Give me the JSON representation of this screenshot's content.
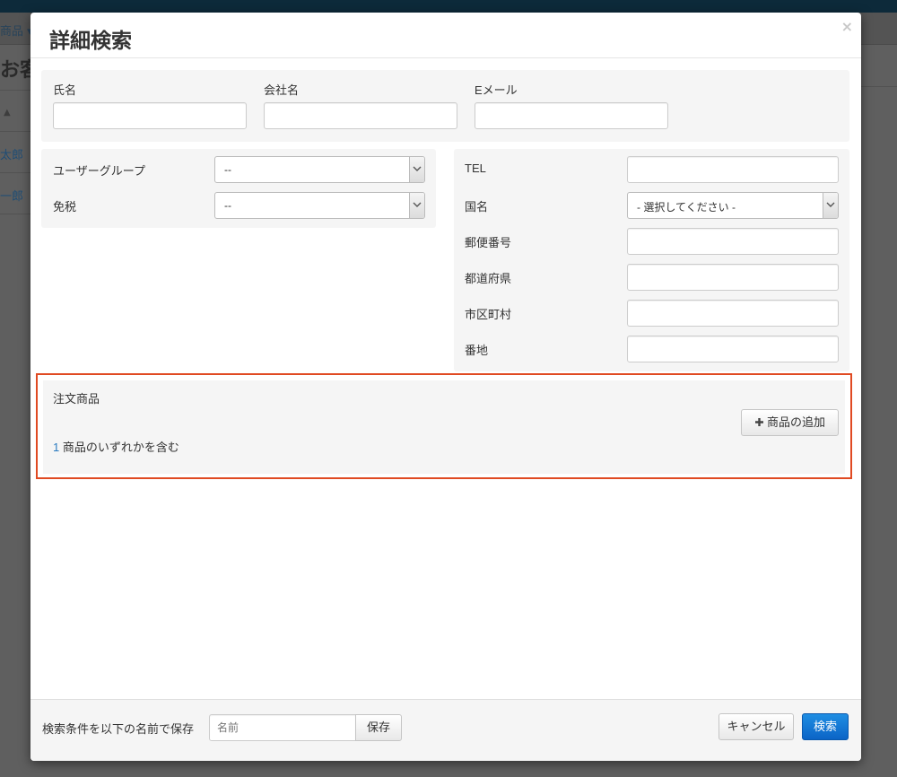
{
  "background": {
    "nav_text": "商品 ▾",
    "page_title": "お客様",
    "sort_icon": "sort-up-icon",
    "row_links": [
      "太郎",
      "一郎"
    ]
  },
  "modal": {
    "title": "詳細検索",
    "close": "×",
    "basic": {
      "name_label": "氏名",
      "company_label": "会社名",
      "email_label": "Eメール",
      "name_value": "",
      "company_value": "",
      "email_value": ""
    },
    "left": {
      "user_group_label": "ユーザーグループ",
      "user_group_value": "--",
      "tax_exempt_label": "免税",
      "tax_exempt_value": "--"
    },
    "right": {
      "tel_label": "TEL",
      "country_label": "国名",
      "country_value": "- 選択してください -",
      "zip_label": "郵便番号",
      "state_label": "都道府県",
      "city_label": "市区町村",
      "address_label": "番地",
      "tel_value": "",
      "zip_value": "",
      "state_value": "",
      "city_value": "",
      "address_value": ""
    },
    "order_products": {
      "label": "注文商品",
      "count": "1",
      "condition_text": "商品のいずれかを含む",
      "add_button": "商品の追加",
      "add_icon": "plus-icon"
    },
    "footer": {
      "save_text": "検索条件を以下の名前で保存",
      "name_placeholder": "名前",
      "save_button": "保存",
      "cancel_button": "キャンセル",
      "search_button": "検索"
    }
  },
  "colors": {
    "highlight_border": "#e04a22",
    "primary": "#0b64c6",
    "link": "#2a7bc0"
  }
}
